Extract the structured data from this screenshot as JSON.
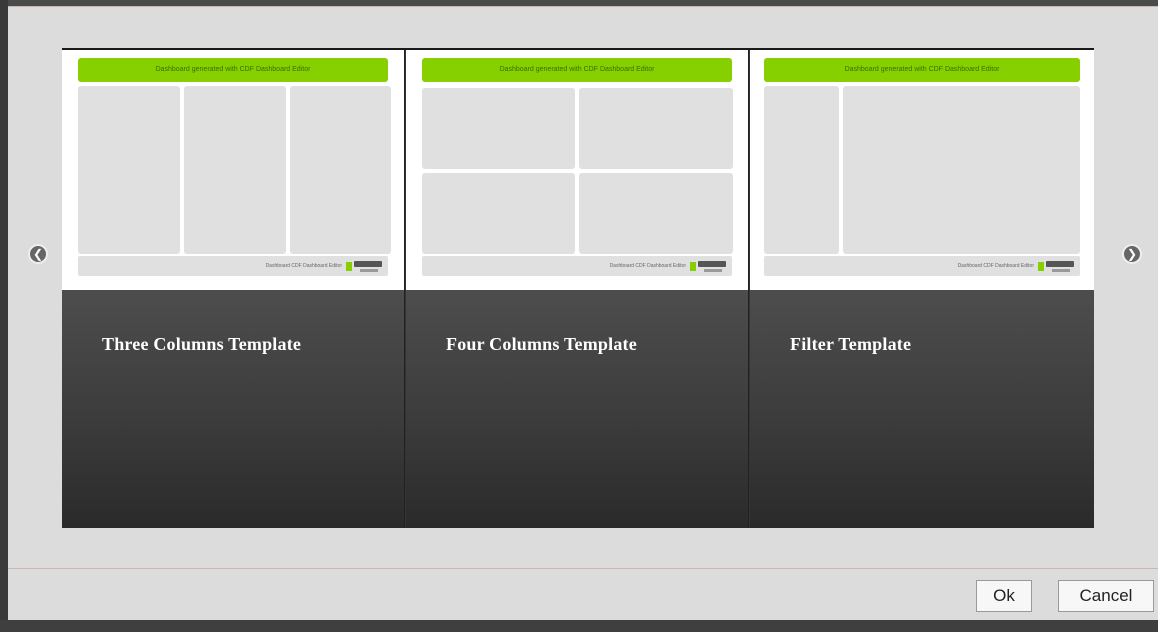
{
  "templates": [
    {
      "title": "Three Columns Template",
      "preview_header": "Dashboard generated with CDF Dashboard Editor",
      "preview_footer": "Dashboard CDF Dashboard Editor"
    },
    {
      "title": "Four Columns Template",
      "preview_header": "Dashboard generated with CDF Dashboard Editor",
      "preview_footer": "Dashboard CDF Dashboard Editor"
    },
    {
      "title": "Filter Template",
      "preview_header": "Dashboard generated with CDF Dashboard Editor",
      "preview_footer": "Dashboard CDF Dashboard Editor"
    }
  ],
  "navigation": {
    "prev_icon": "chevron-left-icon",
    "next_icon": "chevron-right-icon"
  },
  "buttons": {
    "ok_label": "Ok",
    "cancel_label": "Cancel"
  },
  "colors": {
    "accent": "#86d000",
    "card_dark": "#2a2a2a",
    "dialog_bg": "#dcdcdc"
  }
}
